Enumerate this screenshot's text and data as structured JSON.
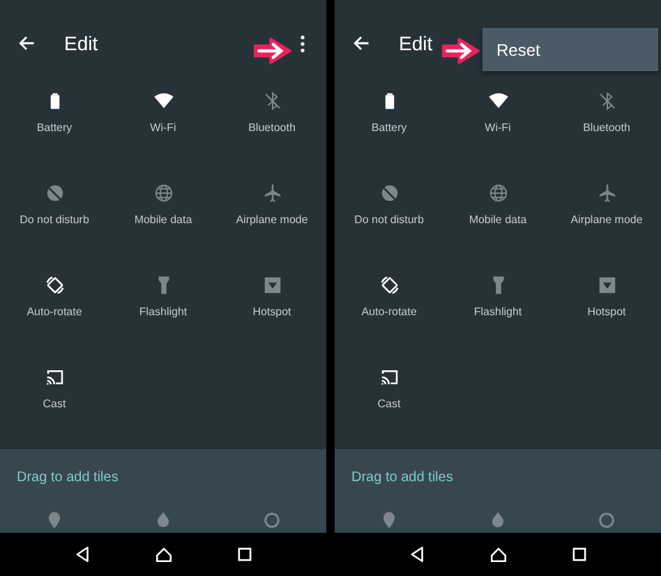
{
  "panels": [
    {
      "title": "Edit",
      "menu_open": false,
      "menu_button_pointed": true,
      "tiles": [
        {
          "label": "Battery",
          "kind": "battery",
          "active": true
        },
        {
          "label": "Wi-Fi",
          "kind": "wifi",
          "active": true
        },
        {
          "label": "Bluetooth",
          "kind": "bluetooth",
          "active": false
        },
        {
          "label": "Do not disturb",
          "kind": "dnd",
          "active": false
        },
        {
          "label": "Mobile data",
          "kind": "globe",
          "active": false
        },
        {
          "label": "Airplane mode",
          "kind": "airplane",
          "active": false
        },
        {
          "label": "Auto-rotate",
          "kind": "rotate",
          "active": true
        },
        {
          "label": "Flashlight",
          "kind": "flashlight",
          "active": false
        },
        {
          "label": "Hotspot",
          "kind": "hotspot",
          "active": false
        },
        {
          "label": "Cast",
          "kind": "cast",
          "active": true
        }
      ],
      "drag_label": "Drag to add tiles"
    },
    {
      "title": "Edit",
      "menu_open": true,
      "menu_items": [
        {
          "label": "Reset",
          "pointed": true
        }
      ],
      "tiles": [
        {
          "label": "Battery",
          "kind": "battery",
          "active": true
        },
        {
          "label": "Wi-Fi",
          "kind": "wifi",
          "active": true
        },
        {
          "label": "Bluetooth",
          "kind": "bluetooth",
          "active": false
        },
        {
          "label": "Do not disturb",
          "kind": "dnd",
          "active": false
        },
        {
          "label": "Mobile data",
          "kind": "globe",
          "active": false
        },
        {
          "label": "Airplane mode",
          "kind": "airplane",
          "active": false
        },
        {
          "label": "Auto-rotate",
          "kind": "rotate",
          "active": true
        },
        {
          "label": "Flashlight",
          "kind": "flashlight",
          "active": false
        },
        {
          "label": "Hotspot",
          "kind": "hotspot",
          "active": false
        },
        {
          "label": "Cast",
          "kind": "cast",
          "active": true
        }
      ],
      "drag_label": "Drag to add tiles"
    }
  ]
}
